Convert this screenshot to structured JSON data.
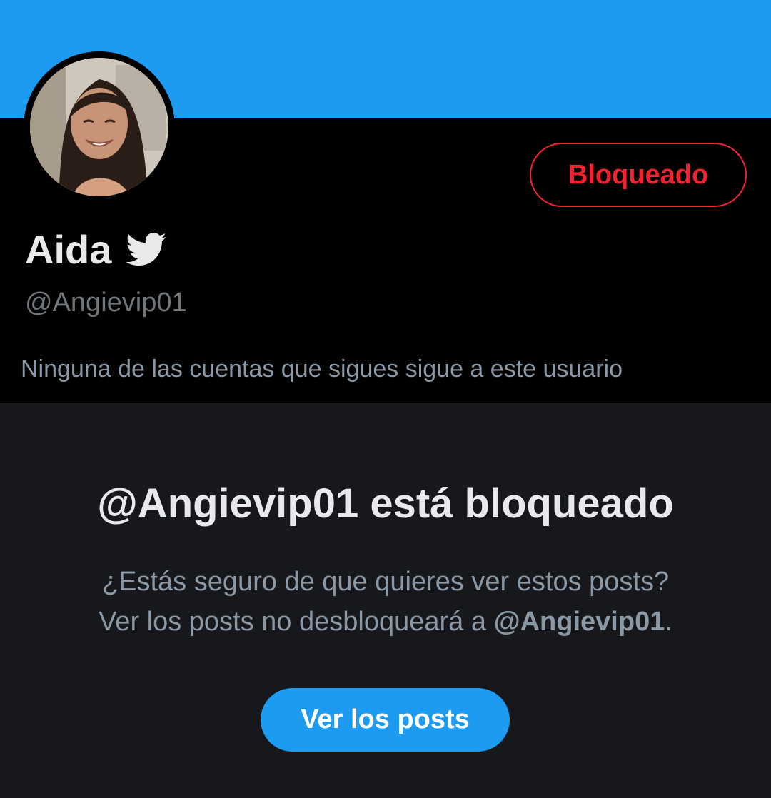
{
  "banner": {
    "color": "#1d9bf0"
  },
  "profile": {
    "display_name": "Aida",
    "badge_icon": "twitter-bird-icon",
    "handle": "@Angievip01",
    "followers_note": "Ninguna de las cuentas que sigues sigue a este usuario",
    "block_button_label": "Bloqueado",
    "avatar": "profile-photo"
  },
  "blocked": {
    "title": "@Angievip01 está bloqueado",
    "line1": "¿Estás seguro de que quieres ver estos posts?",
    "line2_prefix": "Ver los posts no desbloqueará a ",
    "line2_handle": "@Angievip01",
    "line2_suffix": ".",
    "button_label": "Ver los posts"
  },
  "colors": {
    "accent": "#1d9bf0",
    "danger": "#f4212e",
    "background": "#000000",
    "panel": "#16181c",
    "text_primary": "#e7e9ea",
    "text_secondary": "#71767b"
  }
}
